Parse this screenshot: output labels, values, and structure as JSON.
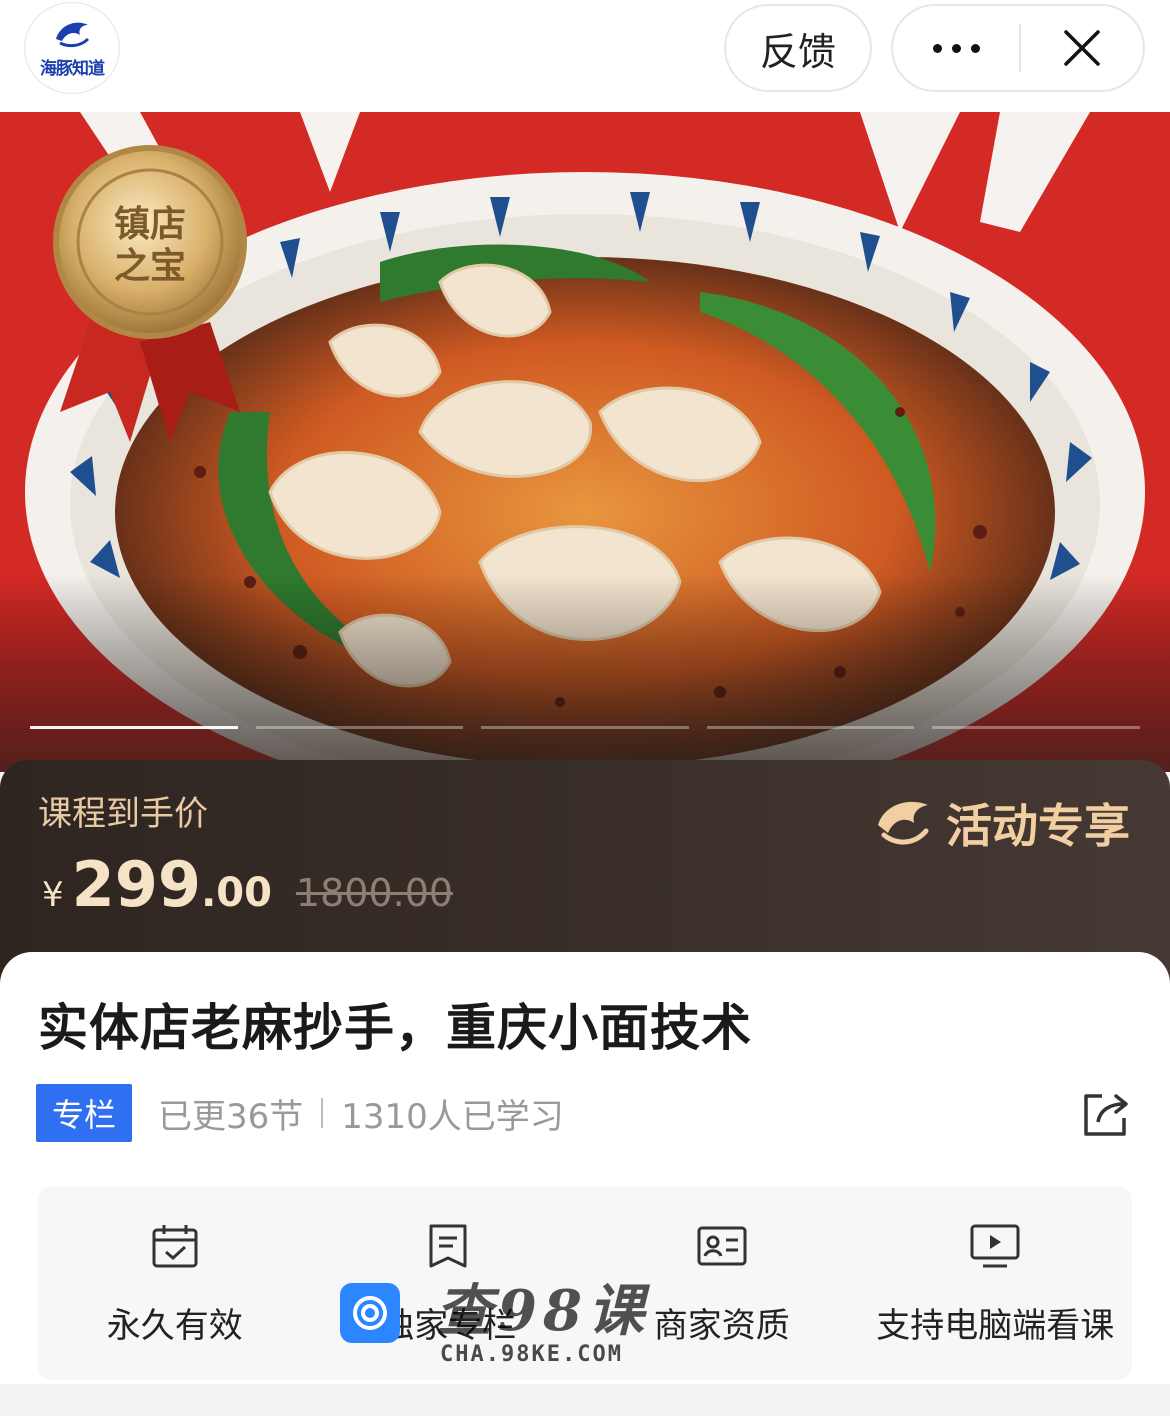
{
  "app": {
    "logo_text": "海豚知道"
  },
  "nav": {
    "feedback_label": "反馈"
  },
  "hero": {
    "badge_text": "镇店之宝",
    "badge_line1": "镇店",
    "badge_line2": "之宝",
    "slide_count": 5,
    "active_slide": 1
  },
  "price": {
    "label": "课程到手价",
    "currency": "¥",
    "integer": "299",
    "decimal": ".00",
    "original": "1800.00",
    "promo_label": "活动专享"
  },
  "course": {
    "title": "实体店老麻抄手，重庆小面技术",
    "tag": "专栏",
    "updates": "已更36节",
    "learners": "1310人已学习"
  },
  "features": [
    {
      "icon": "calendar-check-icon",
      "label": "永久有效"
    },
    {
      "icon": "document-icon",
      "label": "独家专栏"
    },
    {
      "icon": "id-card-icon",
      "label": "商家资质"
    },
    {
      "icon": "monitor-play-icon",
      "label": "支持电脑端看课"
    }
  ],
  "watermark": {
    "main": "查98课",
    "sub": "CHA.98KE.COM"
  },
  "colors": {
    "accent_blue": "#2f6ff2",
    "price_gold": "#f6e3c6",
    "hero_red": "#d42a26"
  }
}
